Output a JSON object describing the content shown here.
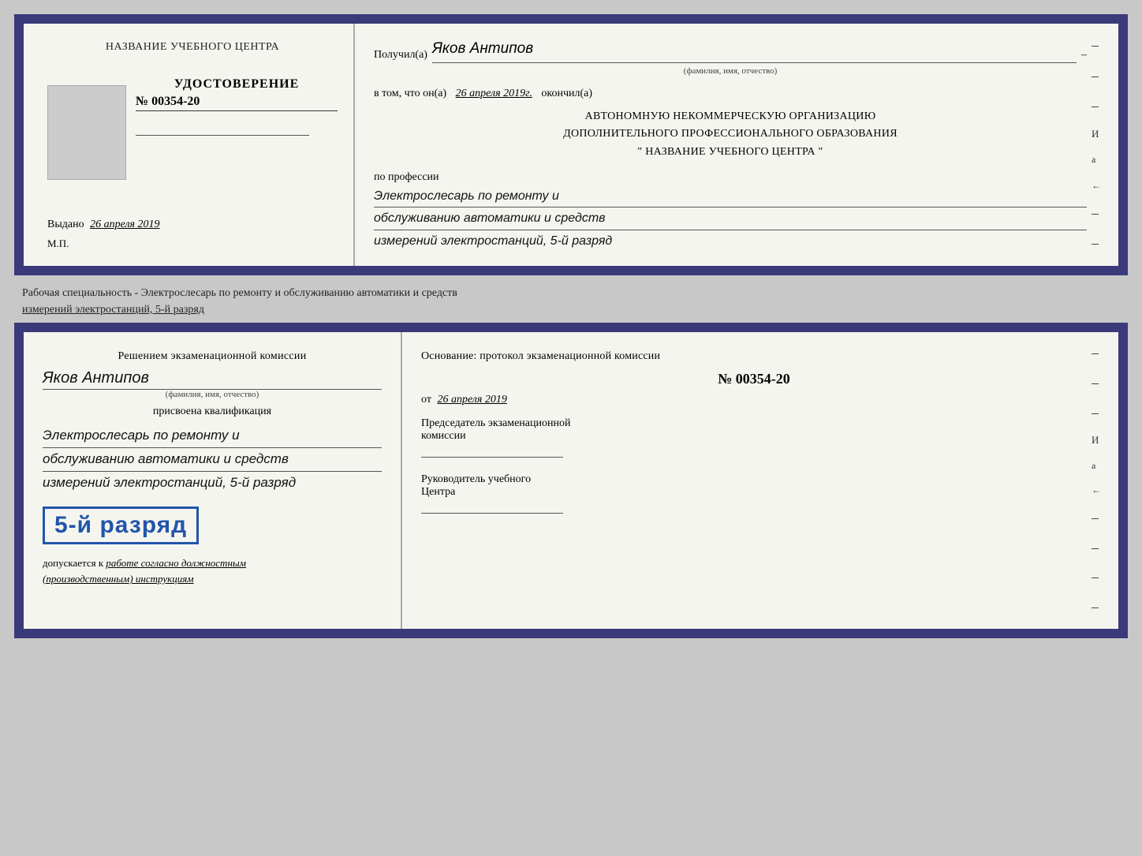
{
  "top_doc": {
    "left": {
      "center_name": "НАЗВАНИЕ УЧЕБНОГО ЦЕНТРА",
      "udost_label": "УДОСТОВЕРЕНИЕ",
      "cert_number": "№ 00354-20",
      "vydano_label": "Выдано",
      "vydano_date": "26 апреля 2019",
      "mp_label": "М.П."
    },
    "right": {
      "poluchil_label": "Получил(а)",
      "recipient_name": "Яков Антипов",
      "fio_sub": "(фамилия, имя, отчество)",
      "vtom_prefix": "в том, что он(а)",
      "vtom_date": "26 апреля 2019г.",
      "okончил_label": "окончил(а)",
      "org_line1": "АВТОНОМНУЮ НЕКОММЕРЧЕСКУЮ ОРГАНИЗАЦИЮ",
      "org_line2": "ДОПОЛНИТЕЛЬНОГО ПРОФЕССИОНАЛЬНОГО ОБРАЗОВАНИЯ",
      "org_quote": "\"   НАЗВАНИЕ УЧЕБНОГО ЦЕНТРА   \"",
      "po_professii": "по профессии",
      "profession_line1": "Электрослесарь по ремонту и",
      "profession_line2": "обслуживанию автоматики и средств",
      "profession_line3": "измерений электростанций, 5-й разряд"
    }
  },
  "middle": {
    "text": "Рабочая специальность - Электрослесарь по ремонту и обслуживанию автоматики и средств",
    "text2": "измерений электростанций, 5-й разряд"
  },
  "bottom_doc": {
    "left": {
      "decision_text": "Решением экзаменационной комиссии",
      "person_name": "Яков Антипов",
      "fio_sub": "(фамилия, имя, отчество)",
      "prisvoena": "присвоена квалификация",
      "qual_line1": "Электрослесарь по ремонту и",
      "qual_line2": "обслуживанию автоматики и средств",
      "qual_line3": "измерений электростанций, 5-й разряд",
      "razryad_badge": "5-й разряд",
      "dopuskaetsya_prefix": "допускается к",
      "dopuskaetsya_italic": "работе согласно должностным",
      "dopuskaetsya_italic2": "(производственным) инструкциям"
    },
    "right": {
      "osnovanie_label": "Основание: протокол экзаменационной комиссии",
      "number": "№  00354-20",
      "ot_label": "от",
      "ot_date": "26 апреля 2019",
      "predsedatel_label": "Председатель экзаменационной",
      "komissii_label": "комиссии",
      "rukovoditel_label": "Руководитель учебного",
      "tsentra_label": "Центра"
    }
  },
  "dashes": [
    "-",
    "-",
    "–",
    "-",
    "а",
    "←",
    "-",
    "-",
    "-",
    "-",
    "-"
  ]
}
